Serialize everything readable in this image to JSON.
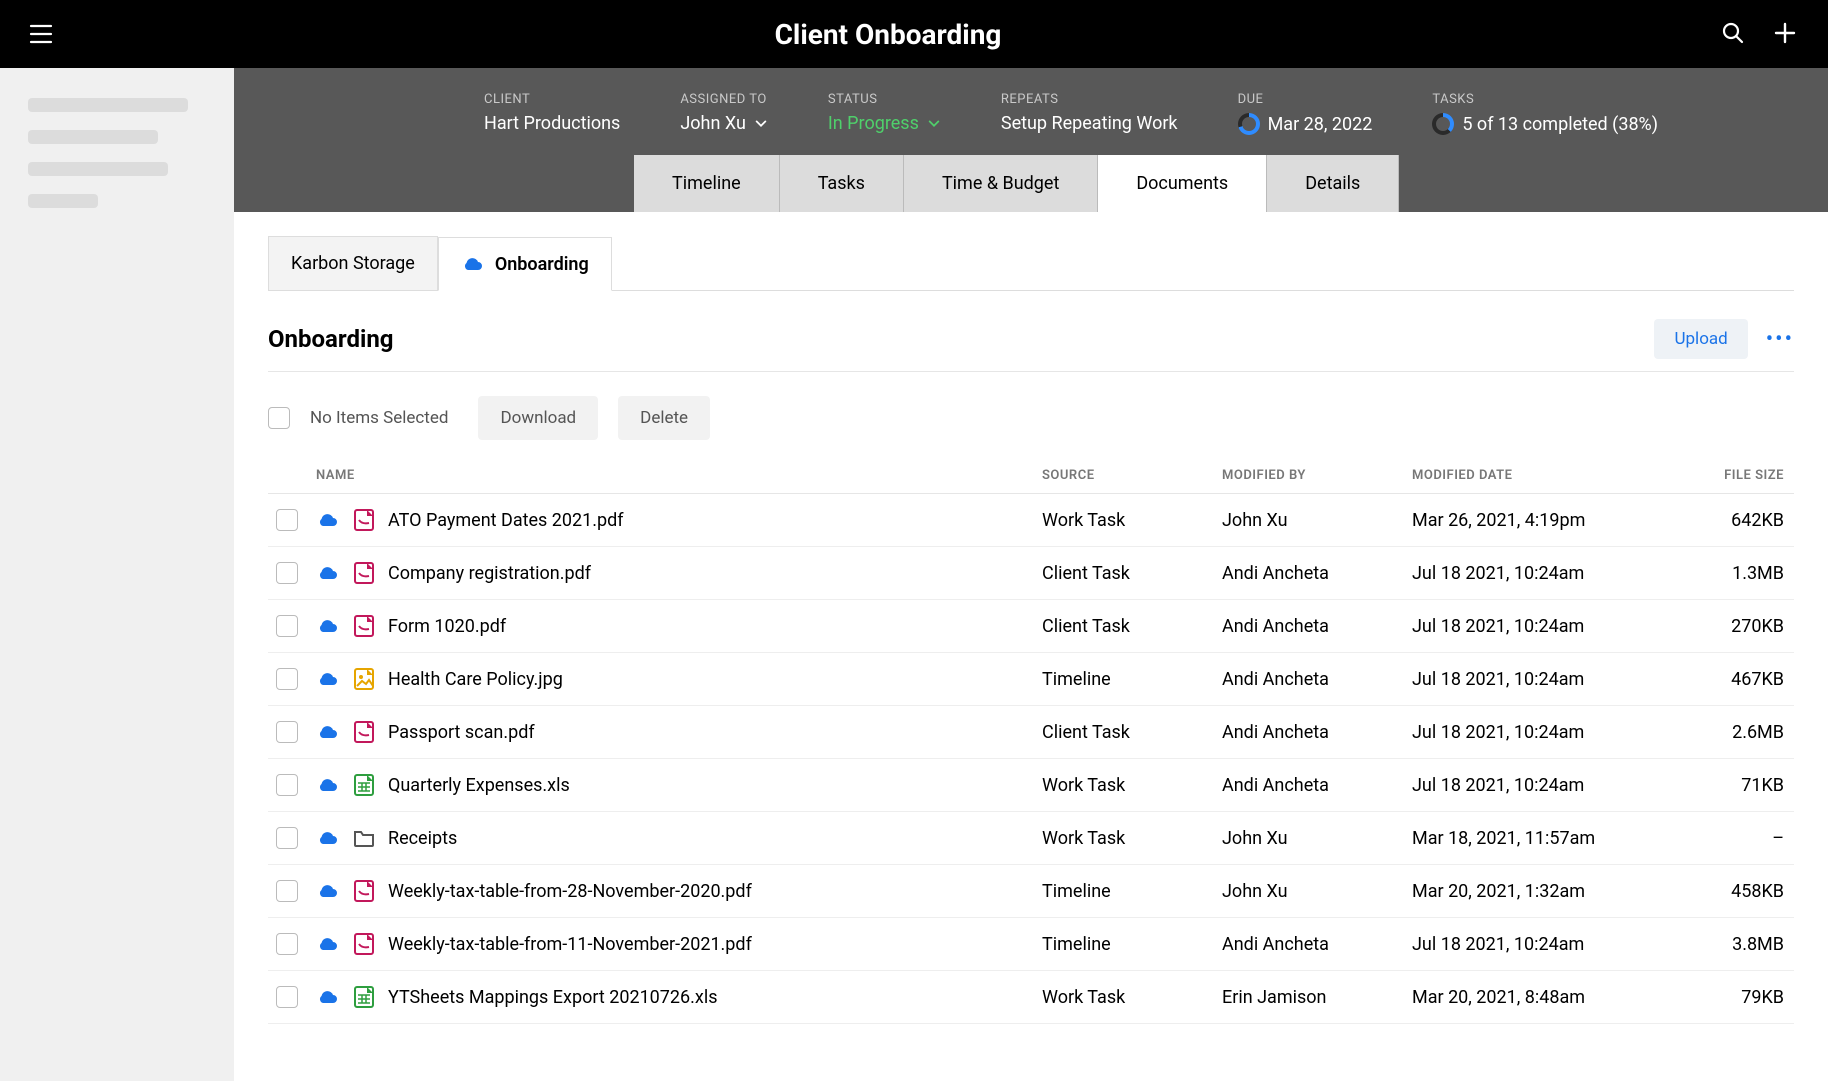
{
  "header": {
    "title": "Client Onboarding"
  },
  "meta": {
    "client_label": "CLIENT",
    "client_value": "Hart Productions",
    "assigned_label": "ASSIGNED TO",
    "assigned_value": "John Xu",
    "status_label": "STATUS",
    "status_value": "In Progress",
    "repeats_label": "REPEATS",
    "repeats_value": "Setup Repeating Work",
    "due_label": "DUE",
    "due_value": "Mar 28, 2022",
    "tasks_label": "TASKS",
    "tasks_value": "5 of 13  completed (38%)"
  },
  "tabs": {
    "timeline": "Timeline",
    "tasks": "Tasks",
    "time_budget": "Time & Budget",
    "documents": "Documents",
    "details": "Details"
  },
  "storage_tabs": {
    "karbon": "Karbon Storage",
    "onboarding": "Onboarding"
  },
  "section": {
    "title": "Onboarding",
    "upload": "Upload"
  },
  "toolbar": {
    "no_items": "No Items Selected",
    "download": "Download",
    "delete": "Delete"
  },
  "columns": {
    "name": "NAME",
    "source": "SOURCE",
    "modified_by": "MODIFIED BY",
    "modified_date": "MODIFIED DATE",
    "file_size": "FILE SIZE"
  },
  "files": [
    {
      "name": "ATO Payment Dates 2021.pdf",
      "type": "pdf",
      "source": "Work Task",
      "modified_by": "John Xu",
      "modified_date": "Mar 26, 2021, 4:19pm",
      "size": "642KB"
    },
    {
      "name": "Company registration.pdf",
      "type": "pdf",
      "source": "Client Task",
      "modified_by": "Andi Ancheta",
      "modified_date": "Jul 18 2021, 10:24am",
      "size": "1.3MB"
    },
    {
      "name": "Form 1020.pdf",
      "type": "pdf",
      "source": "Client Task",
      "modified_by": "Andi Ancheta",
      "modified_date": "Jul 18 2021, 10:24am",
      "size": "270KB"
    },
    {
      "name": "Health Care Policy.jpg",
      "type": "jpg",
      "source": "Timeline",
      "modified_by": "Andi Ancheta",
      "modified_date": "Jul 18 2021, 10:24am",
      "size": "467KB"
    },
    {
      "name": "Passport scan.pdf",
      "type": "pdf",
      "source": "Client Task",
      "modified_by": "Andi Ancheta",
      "modified_date": "Jul 18 2021, 10:24am",
      "size": "2.6MB"
    },
    {
      "name": "Quarterly Expenses.xls",
      "type": "xls",
      "source": "Work Task",
      "modified_by": "Andi Ancheta",
      "modified_date": "Jul 18 2021, 10:24am",
      "size": "71KB"
    },
    {
      "name": "Receipts",
      "type": "folder",
      "source": "Work Task",
      "modified_by": "John Xu",
      "modified_date": "Mar 18, 2021, 11:57am",
      "size": "–"
    },
    {
      "name": "Weekly-tax-table-from-28-November-2020.pdf",
      "type": "pdf",
      "source": "Timeline",
      "modified_by": "John Xu",
      "modified_date": "Mar 20, 2021, 1:32am",
      "size": "458KB"
    },
    {
      "name": "Weekly-tax-table-from-11-November-2021.pdf",
      "type": "pdf",
      "source": "Timeline",
      "modified_by": "Andi Ancheta",
      "modified_date": "Jul 18 2021, 10:24am",
      "size": "3.8MB"
    },
    {
      "name": "YTSheets Mappings Export 20210726.xls",
      "type": "xls",
      "source": "Work Task",
      "modified_by": "Erin Jamison",
      "modified_date": "Mar 20, 2021, 8:48am",
      "size": "79KB"
    }
  ]
}
